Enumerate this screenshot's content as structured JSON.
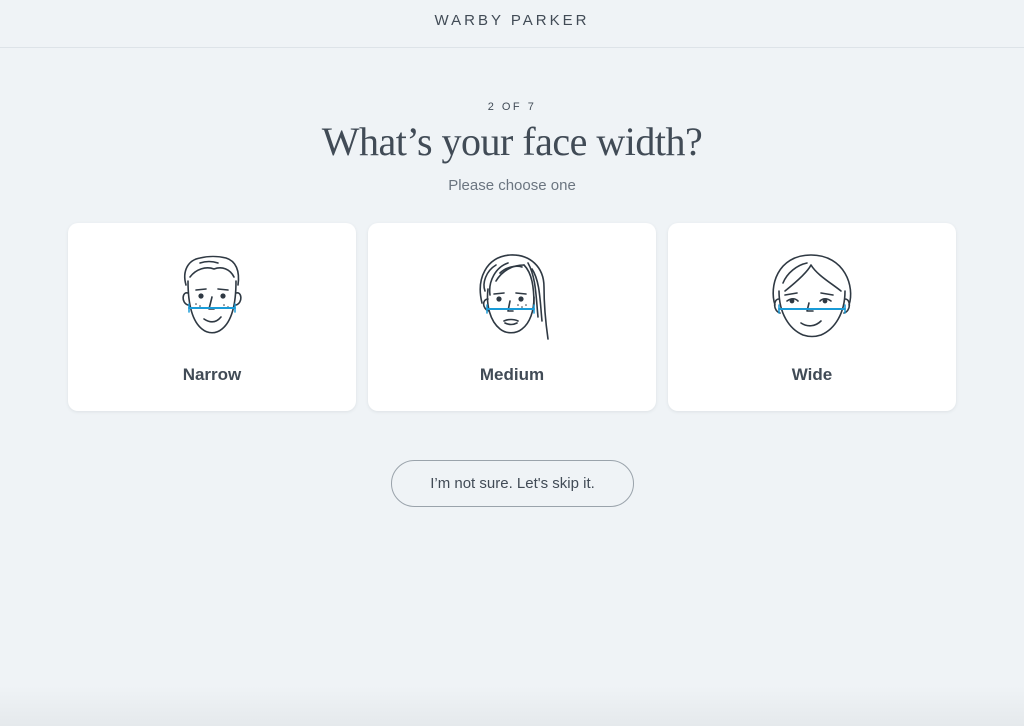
{
  "header": {
    "logo": "WARBY PARKER"
  },
  "quiz": {
    "step": "2 OF 7",
    "title": "What’s your face width?",
    "subtitle": "Please choose one"
  },
  "options": [
    {
      "label": "Narrow",
      "icon": "narrow-face-icon"
    },
    {
      "label": "Medium",
      "icon": "medium-face-icon"
    },
    {
      "label": "Wide",
      "icon": "wide-face-icon"
    }
  ],
  "skip": {
    "label": "I’m not sure. Let's skip it."
  },
  "colors": {
    "text": "#414b56",
    "background": "#eff3f6",
    "accent": "#1a9bd7"
  }
}
